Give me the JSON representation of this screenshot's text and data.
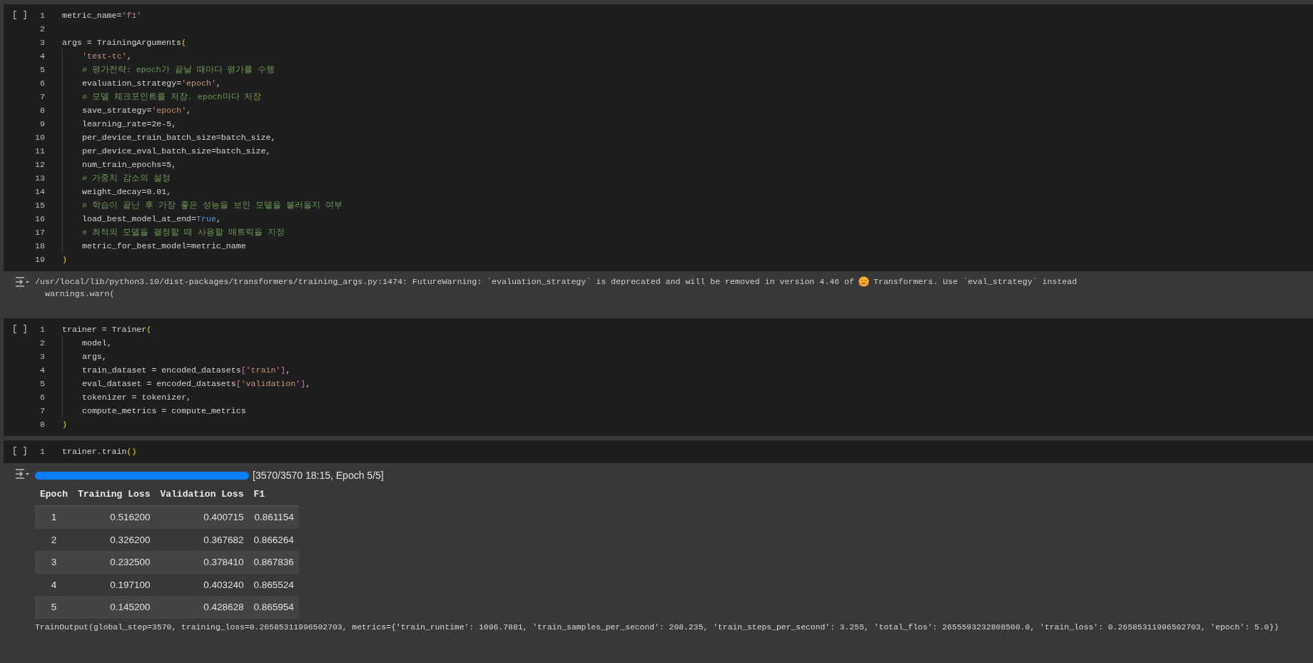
{
  "cells": [
    {
      "run_marker": "[ ]",
      "lines": [
        {
          "number": "1",
          "indented": false,
          "tokens": [
            {
              "kind": "plain",
              "text": "metric_name="
            },
            {
              "kind": "string",
              "text": "'f1'"
            }
          ]
        },
        {
          "number": "2",
          "indented": false
        },
        {
          "number": "3",
          "indented": false,
          "tokens": [
            {
              "kind": "plain",
              "text": "args = TrainingArguments"
            },
            {
              "kind": "bracket",
              "text": "("
            }
          ]
        },
        {
          "number": "4",
          "indented": true,
          "tokens": [
            {
              "kind": "string",
              "text": "'test-tc'"
            },
            {
              "kind": "plain",
              "text": ","
            }
          ]
        },
        {
          "number": "5",
          "indented": true,
          "tokens": [
            {
              "kind": "comment",
              "text": "# 평가전략: epoch가 끝날 때마다 평가를 수행"
            }
          ]
        },
        {
          "number": "6",
          "indented": true,
          "tokens": [
            {
              "kind": "plain",
              "text": "evaluation_strategy="
            },
            {
              "kind": "string",
              "text": "'epoch'"
            },
            {
              "kind": "plain",
              "text": ","
            }
          ]
        },
        {
          "number": "7",
          "indented": true,
          "tokens": [
            {
              "kind": "comment",
              "text": "# 모델 체크포인트를 저장. epoch마다 저장"
            }
          ]
        },
        {
          "number": "8",
          "indented": true,
          "tokens": [
            {
              "kind": "plain",
              "text": "save_strategy="
            },
            {
              "kind": "string",
              "text": "'epoch'"
            },
            {
              "kind": "plain",
              "text": ","
            }
          ]
        },
        {
          "number": "9",
          "indented": true,
          "tokens": [
            {
              "kind": "plain",
              "text": "learning_rate=2e-5,"
            }
          ]
        },
        {
          "number": "10",
          "indented": true,
          "tokens": [
            {
              "kind": "plain",
              "text": "per_device_train_batch_size=batch_size,"
            }
          ]
        },
        {
          "number": "11",
          "indented": true,
          "tokens": [
            {
              "kind": "plain",
              "text": "per_device_eval_batch_size=batch_size,"
            }
          ]
        },
        {
          "number": "12",
          "indented": true,
          "tokens": [
            {
              "kind": "plain",
              "text": "num_train_epochs=5,"
            }
          ]
        },
        {
          "number": "13",
          "indented": true,
          "tokens": [
            {
              "kind": "comment",
              "text": "# 가중치 감소의 설정"
            }
          ]
        },
        {
          "number": "14",
          "indented": true,
          "tokens": [
            {
              "kind": "plain",
              "text": "weight_decay=0.01,"
            }
          ]
        },
        {
          "number": "15",
          "indented": true,
          "tokens": [
            {
              "kind": "comment",
              "text": "# 학습이 끝난 후 가장 좋은 성능을 보인 모델을 불러올지 여부"
            }
          ]
        },
        {
          "number": "16",
          "indented": true,
          "tokens": [
            {
              "kind": "plain",
              "text": "load_best_model_at_end="
            },
            {
              "kind": "keyword",
              "text": "True"
            },
            {
              "kind": "plain",
              "text": ","
            }
          ]
        },
        {
          "number": "17",
          "indented": true,
          "tokens": [
            {
              "kind": "comment",
              "text": "# 최적의 모델을 결정할 때 사용할 매트릭을 지정"
            }
          ]
        },
        {
          "number": "18",
          "indented": true,
          "tokens": [
            {
              "kind": "plain",
              "text": "metric_for_best_model=metric_name"
            }
          ]
        },
        {
          "number": "19",
          "indented": false,
          "tokens": [
            {
              "kind": "bracket",
              "text": ")"
            }
          ]
        }
      ],
      "output": {
        "kind": "warning",
        "text_before_icon": "/usr/local/lib/python3.10/dist-packages/transformers/training_args.py:1474: FutureWarning: `evaluation_strategy` is deprecated and will be removed in version 4.46 of",
        "text_after_icon": "Transformers. Use `eval_strategy` instead",
        "second_line": "warnings.warn("
      }
    },
    {
      "run_marker": "[ ]",
      "lines": [
        {
          "number": "1",
          "indented": false,
          "tokens": [
            {
              "kind": "plain",
              "text": "trainer = Trainer"
            },
            {
              "kind": "bracket",
              "text": "("
            }
          ]
        },
        {
          "number": "2",
          "indented": true,
          "tokens": [
            {
              "kind": "plain",
              "text": "model,"
            }
          ]
        },
        {
          "number": "3",
          "indented": true,
          "tokens": [
            {
              "kind": "plain",
              "text": "args,"
            }
          ]
        },
        {
          "number": "4",
          "indented": true,
          "tokens": [
            {
              "kind": "plain",
              "text": "train_dataset = encoded_datasets"
            },
            {
              "kind": "bracket2",
              "text": "["
            },
            {
              "kind": "string",
              "text": "'train'"
            },
            {
              "kind": "bracket2",
              "text": "]"
            },
            {
              "kind": "plain",
              "text": ","
            }
          ]
        },
        {
          "number": "5",
          "indented": true,
          "tokens": [
            {
              "kind": "plain",
              "text": "eval_dataset = encoded_datasets"
            },
            {
              "kind": "bracket2",
              "text": "["
            },
            {
              "kind": "string",
              "text": "'validation'"
            },
            {
              "kind": "bracket2",
              "text": "]"
            },
            {
              "kind": "plain",
              "text": ","
            }
          ]
        },
        {
          "number": "6",
          "indented": true,
          "tokens": [
            {
              "kind": "plain",
              "text": "tokenizer = tokenizer,"
            }
          ]
        },
        {
          "number": "7",
          "indented": true,
          "tokens": [
            {
              "kind": "plain",
              "text": "compute_metrics = compute_metrics"
            }
          ]
        },
        {
          "number": "8",
          "indented": false,
          "tokens": [
            {
              "kind": "bracket",
              "text": ")"
            }
          ]
        }
      ]
    },
    {
      "run_marker": "[ ]",
      "lines": [
        {
          "number": "1",
          "indented": false,
          "tokens": [
            {
              "kind": "plain",
              "text": "trainer.train"
            },
            {
              "kind": "bracket",
              "text": "()"
            }
          ]
        }
      ],
      "output": {
        "kind": "training",
        "progress": {
          "level": 1.0,
          "status": "[3570/3570 18:15, Epoch 5/5]"
        },
        "table": {
          "columns": [
            "Epoch",
            "Training Loss",
            "Validation Loss",
            "F1"
          ],
          "rows": [
            [
              "1",
              "0.516200",
              "0.400715",
              "0.861154"
            ],
            [
              "2",
              "0.326200",
              "0.367682",
              "0.866264"
            ],
            [
              "3",
              "0.232500",
              "0.378410",
              "0.867836"
            ],
            [
              "4",
              "0.197100",
              "0.403240",
              "0.865524"
            ],
            [
              "5",
              "0.145200",
              "0.428628",
              "0.865954"
            ]
          ]
        },
        "result": "TrainOutput(global_step=3570, training_loss=0.26585311996502703, metrics={'train_runtime': 1096.7881, 'train_samples_per_second': 208.235, 'train_steps_per_second': 3.255, 'total_flos': 2655593232808500.0, 'train_loss': 0.26585311996502703, 'epoch': 5.0})"
      }
    }
  ]
}
